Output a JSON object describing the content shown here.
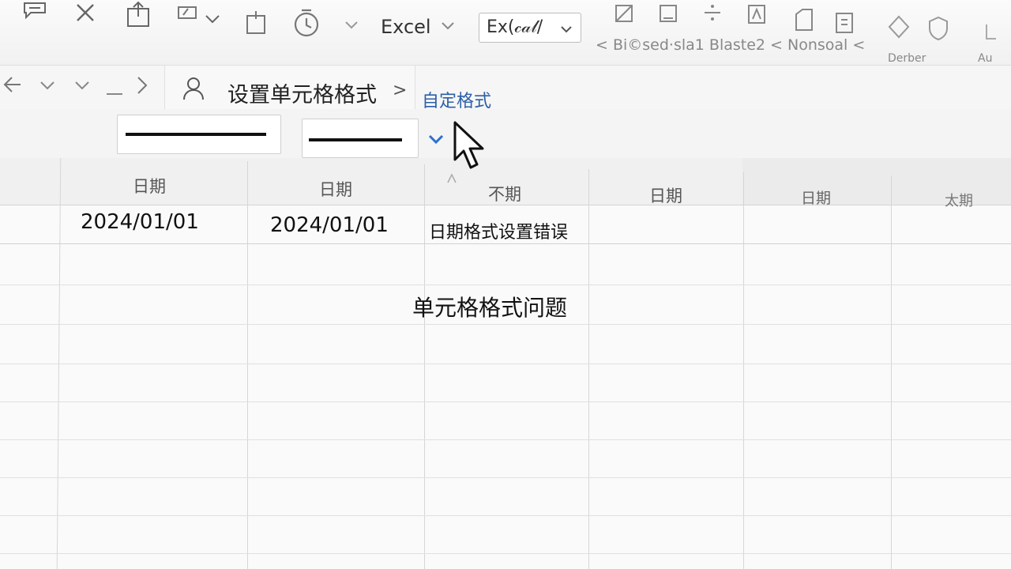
{
  "toolbar": {
    "app_label": "Excel",
    "combo_value": "Ex(𝒸𝒶𝓁/",
    "right_group_text": "< Bi©sed·sla1  Blaste2 < Nonsoal <",
    "tiny_label_1": "Derber",
    "tiny_label_2": "Au"
  },
  "nav": {
    "title": "设置单元格格式",
    "separator": ">",
    "subtitle": "自定格式"
  },
  "grid": {
    "headers": [
      "日期",
      "日期",
      "不期",
      "日期",
      "日期",
      "太期"
    ],
    "row1": [
      "2024/01/01",
      "2024/01/01",
      "日期格式设置错误"
    ],
    "note": "单元格格式问题"
  },
  "colors": {
    "accent": "#2d6fd0",
    "link": "#2d5fa8"
  }
}
